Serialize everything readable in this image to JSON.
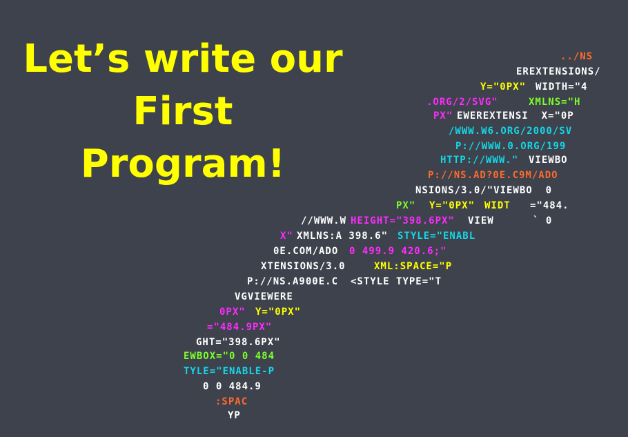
{
  "title": {
    "line1": "Let’s write our",
    "line2": "First",
    "line3": "Program!"
  },
  "colors": {
    "background": "#3d424c",
    "title": "#ffff00",
    "code_white": "#ffffff",
    "code_yellow": "#ffff00",
    "code_magenta": "#ff2bff",
    "code_cyan": "#16d6e8",
    "code_orange": "#ff6a2b",
    "code_green": "#7dff2b"
  },
  "code_art": {
    "segments": [
      {
        "id": "s1",
        "text": "../NS",
        "color": "code_orange"
      },
      {
        "id": "s2",
        "text": "EREXTENSIONS/",
        "color": "code_white"
      },
      {
        "id": "s3",
        "text": "Y=\"0PX\"",
        "color": "code_yellow"
      },
      {
        "id": "s4",
        "text": "WIDTH=\"4",
        "color": "code_white"
      },
      {
        "id": "s5",
        "text": ".ORG/2/SVG\"",
        "color": "code_magenta"
      },
      {
        "id": "s6",
        "text": "XMLNS=\"H",
        "color": "code_green"
      },
      {
        "id": "s7",
        "text": "PX\"",
        "color": "code_magenta"
      },
      {
        "id": "s8",
        "text": "EWEREXTENSI  X=\"0P",
        "color": "code_white"
      },
      {
        "id": "s9",
        "text": "/WWW.W6.ORG/2000/SV",
        "color": "code_cyan"
      },
      {
        "id": "s10",
        "text": "P://WWW.0.ORG/199",
        "color": "code_cyan"
      },
      {
        "id": "s11",
        "text": "HTTP://WWW.\"",
        "color": "code_cyan"
      },
      {
        "id": "s12",
        "text": "VIEWBO",
        "color": "code_white"
      },
      {
        "id": "s13",
        "text": "P://NS.AD?0E.C9M/ADO",
        "color": "code_orange"
      },
      {
        "id": "s14",
        "text": "NSIONS/3.0/\"VIEWBO  0",
        "color": "code_white"
      },
      {
        "id": "s15",
        "text": "PX\"",
        "color": "code_green"
      },
      {
        "id": "s16",
        "text": "Y=\"0PX\"",
        "color": "code_yellow"
      },
      {
        "id": "s17",
        "text": "WIDT",
        "color": "code_yellow"
      },
      {
        "id": "s18",
        "text": "=\"484.",
        "color": "code_white"
      },
      {
        "id": "s19",
        "text": "//WWW.W",
        "color": "code_white"
      },
      {
        "id": "s20",
        "text": "HEIGHT=\"398.6PX\"",
        "color": "code_magenta"
      },
      {
        "id": "s21",
        "text": "VIEW",
        "color": "code_white"
      },
      {
        "id": "s22",
        "text": "` 0",
        "color": "code_white"
      },
      {
        "id": "s23",
        "text": "X\"",
        "color": "code_magenta"
      },
      {
        "id": "s24",
        "text": "XMLNS:A 398.6\"",
        "color": "code_white"
      },
      {
        "id": "s25",
        "text": "STYLE=\"ENABL",
        "color": "code_cyan"
      },
      {
        "id": "s26",
        "text": "0E.COM/ADO",
        "color": "code_white"
      },
      {
        "id": "s27",
        "text": "0 499.9 420.6;\"",
        "color": "code_magenta"
      },
      {
        "id": "s28",
        "text": "XTENSIONS/3.0",
        "color": "code_white"
      },
      {
        "id": "s29",
        "text": "XML:SPACE=\"P",
        "color": "code_yellow"
      },
      {
        "id": "s30",
        "text": "P://NS.A900E.C",
        "color": "code_white"
      },
      {
        "id": "s31",
        "text": "<STYLE TYPE=\"T",
        "color": "code_white"
      },
      {
        "id": "s32",
        "text": "VGVIEWERE",
        "color": "code_white"
      },
      {
        "id": "s33",
        "text": "0PX\"",
        "color": "code_magenta"
      },
      {
        "id": "s34",
        "text": "Y=\"0PX\"",
        "color": "code_yellow"
      },
      {
        "id": "s35",
        "text": "=\"484.9PX\"",
        "color": "code_magenta"
      },
      {
        "id": "s36",
        "text": "GHT=\"398.6PX\"",
        "color": "code_white"
      },
      {
        "id": "s37",
        "text": "EWBOX=\"0 0 484",
        "color": "code_green"
      },
      {
        "id": "s38",
        "text": "TYLE=\"ENABLE-P",
        "color": "code_cyan"
      },
      {
        "id": "s39",
        "text": "0 0 484.9",
        "color": "code_white"
      },
      {
        "id": "s40",
        "text": ":SPAC",
        "color": "code_orange"
      },
      {
        "id": "s41",
        "text": "YP",
        "color": "code_white"
      }
    ]
  }
}
